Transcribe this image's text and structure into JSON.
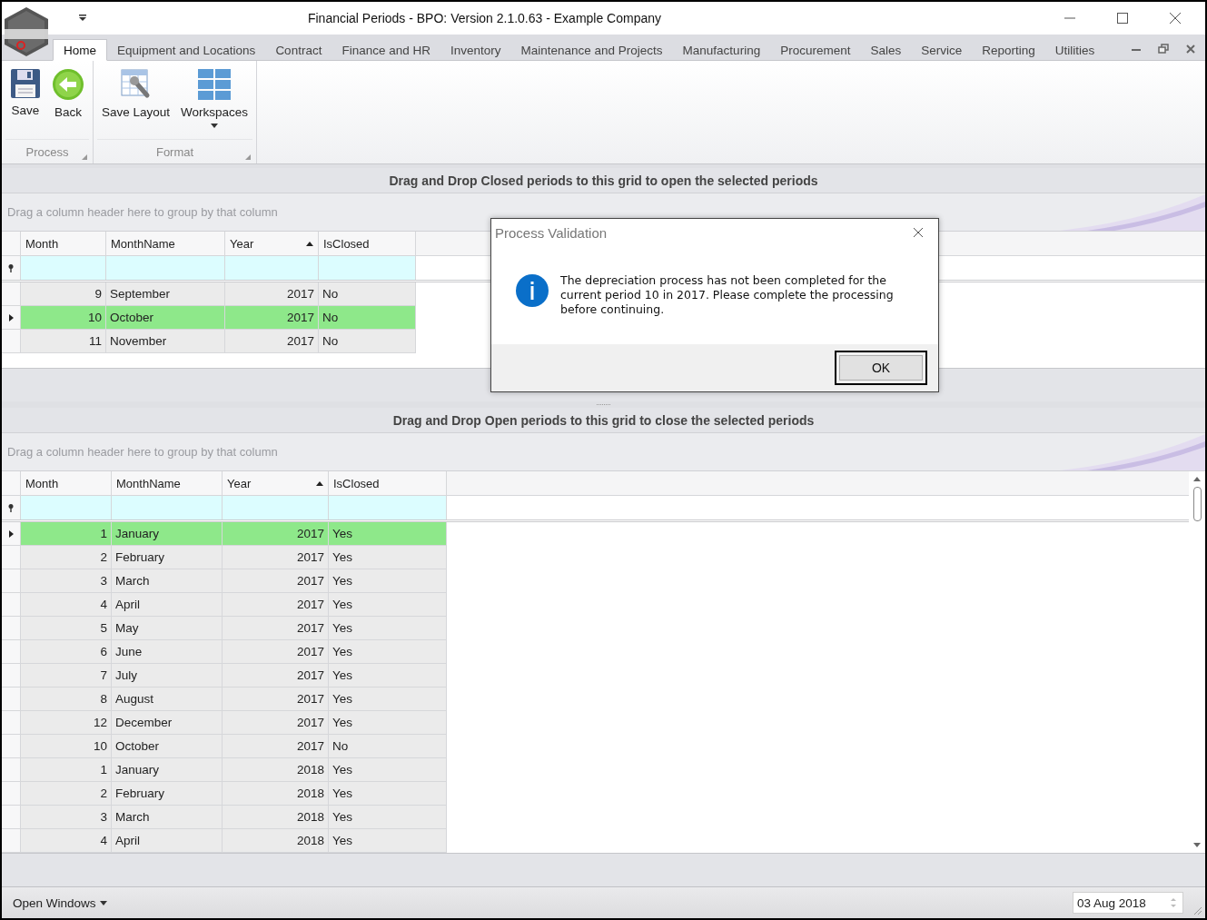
{
  "window": {
    "title": "Financial Periods - BPO: Version 2.1.0.63 - Example Company"
  },
  "tabs": [
    {
      "label": "Home",
      "selected": true
    },
    {
      "label": "Equipment and Locations",
      "selected": false
    },
    {
      "label": "Contract",
      "selected": false
    },
    {
      "label": "Finance and HR",
      "selected": false
    },
    {
      "label": "Inventory",
      "selected": false
    },
    {
      "label": "Maintenance and Projects",
      "selected": false
    },
    {
      "label": "Manufacturing",
      "selected": false
    },
    {
      "label": "Procurement",
      "selected": false
    },
    {
      "label": "Sales",
      "selected": false
    },
    {
      "label": "Service",
      "selected": false
    },
    {
      "label": "Reporting",
      "selected": false
    },
    {
      "label": "Utilities",
      "selected": false
    }
  ],
  "ribbon_groups": [
    {
      "label": "Process",
      "buttons": [
        {
          "label": "Save",
          "kind": "save",
          "dropdown": false
        },
        {
          "label": "Back",
          "kind": "back",
          "dropdown": false
        }
      ]
    },
    {
      "label": "Format",
      "buttons": [
        {
          "label": "Save Layout",
          "kind": "layout",
          "dropdown": false
        },
        {
          "label": "Workspaces",
          "kind": "workspaces",
          "dropdown": true
        }
      ]
    }
  ],
  "grids": [
    {
      "title": "Drag and Drop Closed periods to this grid to open the selected periods",
      "group_hint": "Drag a column header here to group by that column",
      "columns": [
        {
          "label": "Month",
          "sorted": false
        },
        {
          "label": "MonthName",
          "sorted": false
        },
        {
          "label": "Year",
          "sorted": true
        },
        {
          "label": "IsClosed",
          "sorted": false
        }
      ],
      "rows": [
        {
          "month": "9",
          "month_name": "September",
          "year": "2017",
          "is_closed": "No",
          "selected": false
        },
        {
          "month": "10",
          "month_name": "October",
          "year": "2017",
          "is_closed": "No",
          "selected": true
        },
        {
          "month": "11",
          "month_name": "November",
          "year": "2017",
          "is_closed": "No",
          "selected": false
        }
      ]
    },
    {
      "title": "Drag and Drop Open periods to this grid to close the selected periods",
      "group_hint": "Drag a column header here to group by that column",
      "columns": [
        {
          "label": "Month",
          "sorted": false
        },
        {
          "label": "MonthName",
          "sorted": false
        },
        {
          "label": "Year",
          "sorted": true
        },
        {
          "label": "IsClosed",
          "sorted": false
        }
      ],
      "rows": [
        {
          "month": "1",
          "month_name": "January",
          "year": "2017",
          "is_closed": "Yes",
          "selected": true
        },
        {
          "month": "2",
          "month_name": "February",
          "year": "2017",
          "is_closed": "Yes",
          "selected": false
        },
        {
          "month": "3",
          "month_name": "March",
          "year": "2017",
          "is_closed": "Yes",
          "selected": false
        },
        {
          "month": "4",
          "month_name": "April",
          "year": "2017",
          "is_closed": "Yes",
          "selected": false
        },
        {
          "month": "5",
          "month_name": "May",
          "year": "2017",
          "is_closed": "Yes",
          "selected": false
        },
        {
          "month": "6",
          "month_name": "June",
          "year": "2017",
          "is_closed": "Yes",
          "selected": false
        },
        {
          "month": "7",
          "month_name": "July",
          "year": "2017",
          "is_closed": "Yes",
          "selected": false
        },
        {
          "month": "8",
          "month_name": "August",
          "year": "2017",
          "is_closed": "Yes",
          "selected": false
        },
        {
          "month": "12",
          "month_name": "December",
          "year": "2017",
          "is_closed": "Yes",
          "selected": false
        },
        {
          "month": "10",
          "month_name": "October",
          "year": "2017",
          "is_closed": "No",
          "selected": false
        },
        {
          "month": "1",
          "month_name": "January",
          "year": "2018",
          "is_closed": "Yes",
          "selected": false
        },
        {
          "month": "2",
          "month_name": "February",
          "year": "2018",
          "is_closed": "Yes",
          "selected": false
        },
        {
          "month": "3",
          "month_name": "March",
          "year": "2018",
          "is_closed": "Yes",
          "selected": false
        },
        {
          "month": "4",
          "month_name": "April",
          "year": "2018",
          "is_closed": "Yes",
          "selected": false
        }
      ]
    }
  ],
  "dialog": {
    "title": "Process Validation",
    "message": "The depreciation process has not been completed for the current period 10 in 2017.  Please complete the processing before continuing.",
    "button": "OK"
  },
  "status_bar": {
    "menu": "Open Windows",
    "date": "03 Aug 2018"
  }
}
